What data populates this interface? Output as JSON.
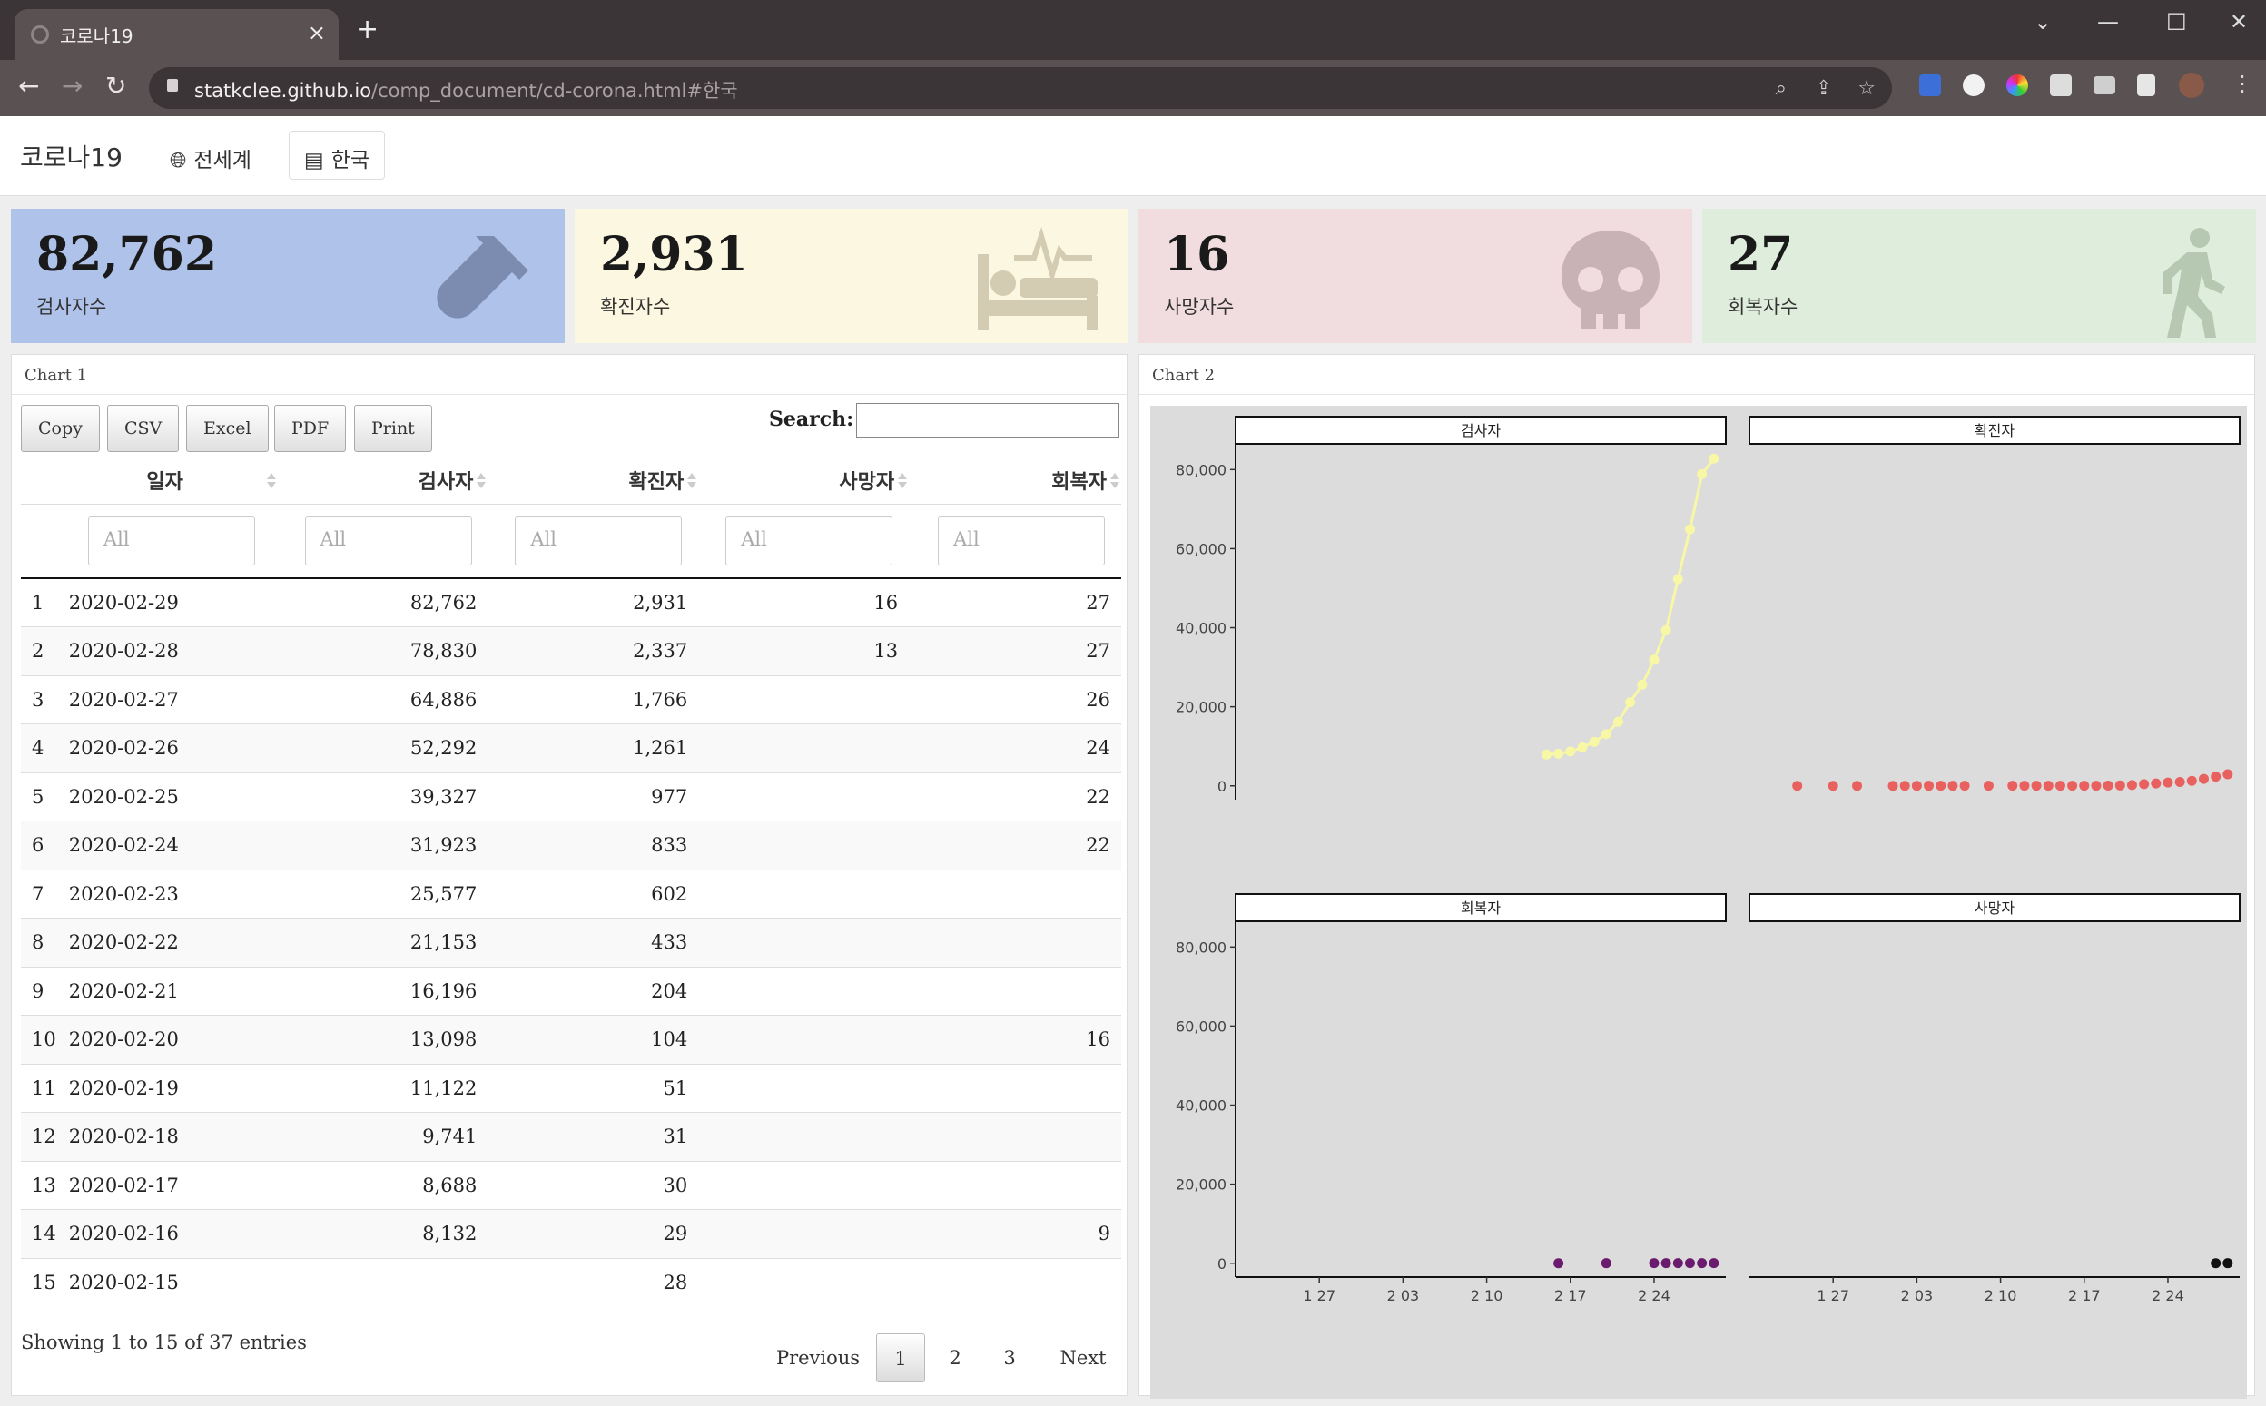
{
  "browser": {
    "tab_title": "코로나19",
    "tab_close": "×",
    "new_tab": "+",
    "url_domain": "statkclee.github.io",
    "url_path": "/comp_document/cd-corona.html#한국",
    "back": "←",
    "forward": "→",
    "reload": "↻"
  },
  "navbar": {
    "brand": "코로나19",
    "links": [
      {
        "label": "전세계",
        "icon": "globe-icon"
      },
      {
        "label": "한국",
        "icon": "map-icon",
        "active": true
      }
    ]
  },
  "value_boxes": [
    {
      "value": "82,762",
      "caption": "검사자수",
      "color": "#afc2ea",
      "icon": "vial-icon"
    },
    {
      "value": "2,931",
      "caption": "확진자수",
      "color": "#fcf7e0",
      "icon": "procedures-icon"
    },
    {
      "value": "16",
      "caption": "사망자수",
      "color": "#f1dce0",
      "icon": "skull-icon"
    },
    {
      "value": "27",
      "caption": "회복자수",
      "color": "#dfeddc",
      "icon": "walking-icon"
    }
  ],
  "chart1": {
    "title": "Chart 1",
    "buttons": [
      "Copy",
      "CSV",
      "Excel",
      "PDF",
      "Print"
    ],
    "search_label": "Search:",
    "columns": [
      "",
      "일자",
      "검사자",
      "확진자",
      "사망자",
      "회복자"
    ],
    "filter_placeholder": "All",
    "rows": [
      [
        "1",
        "2020-02-29",
        "82,762",
        "2,931",
        "16",
        "27"
      ],
      [
        "2",
        "2020-02-28",
        "78,830",
        "2,337",
        "13",
        "27"
      ],
      [
        "3",
        "2020-02-27",
        "64,886",
        "1,766",
        "",
        "26"
      ],
      [
        "4",
        "2020-02-26",
        "52,292",
        "1,261",
        "",
        "24"
      ],
      [
        "5",
        "2020-02-25",
        "39,327",
        "977",
        "",
        "22"
      ],
      [
        "6",
        "2020-02-24",
        "31,923",
        "833",
        "",
        "22"
      ],
      [
        "7",
        "2020-02-23",
        "25,577",
        "602",
        "",
        ""
      ],
      [
        "8",
        "2020-02-22",
        "21,153",
        "433",
        "",
        ""
      ],
      [
        "9",
        "2020-02-21",
        "16,196",
        "204",
        "",
        ""
      ],
      [
        "10",
        "2020-02-20",
        "13,098",
        "104",
        "",
        "16"
      ],
      [
        "11",
        "2020-02-19",
        "11,122",
        "51",
        "",
        ""
      ],
      [
        "12",
        "2020-02-18",
        "9,741",
        "31",
        "",
        ""
      ],
      [
        "13",
        "2020-02-17",
        "8,688",
        "30",
        "",
        ""
      ],
      [
        "14",
        "2020-02-16",
        "8,132",
        "29",
        "",
        "9"
      ],
      [
        "15",
        "2020-02-15",
        "",
        "28",
        "",
        ""
      ]
    ],
    "info": "Showing 1 to 15 of 37 entries",
    "pagination": {
      "previous": "Previous",
      "pages": [
        "1",
        "2",
        "3"
      ],
      "current": "1",
      "next": "Next"
    }
  },
  "chart2": {
    "title": "Chart 2"
  },
  "chart_data": {
    "type": "scatter",
    "facets": [
      {
        "title": "검사자",
        "color": "#f8f7a6",
        "x": [
          "2020-02-15",
          "2020-02-16",
          "2020-02-17",
          "2020-02-18",
          "2020-02-19",
          "2020-02-20",
          "2020-02-21",
          "2020-02-22",
          "2020-02-23",
          "2020-02-24",
          "2020-02-25",
          "2020-02-26",
          "2020-02-27",
          "2020-02-28",
          "2020-02-29"
        ],
        "y": [
          7919,
          8132,
          8688,
          9741,
          11122,
          13098,
          16196,
          21153,
          25577,
          31923,
          39327,
          52292,
          64886,
          78830,
          82762
        ],
        "line": true
      },
      {
        "title": "확진자",
        "color": "#e8615f",
        "x": [
          "2020-01-24",
          "2020-01-27",
          "2020-01-29",
          "2020-02-01",
          "2020-02-02",
          "2020-02-03",
          "2020-02-04",
          "2020-02-05",
          "2020-02-06",
          "2020-02-07",
          "2020-02-09",
          "2020-02-11",
          "2020-02-12",
          "2020-02-13",
          "2020-02-14",
          "2020-02-15",
          "2020-02-16",
          "2020-02-17",
          "2020-02-18",
          "2020-02-19",
          "2020-02-20",
          "2020-02-21",
          "2020-02-22",
          "2020-02-23",
          "2020-02-24",
          "2020-02-25",
          "2020-02-26",
          "2020-02-27",
          "2020-02-28",
          "2020-02-29"
        ],
        "y": [
          2,
          4,
          4,
          12,
          15,
          15,
          16,
          19,
          23,
          24,
          25,
          28,
          28,
          28,
          28,
          28,
          29,
          30,
          31,
          51,
          104,
          204,
          433,
          602,
          833,
          977,
          1261,
          1766,
          2337,
          2931
        ],
        "line": false
      },
      {
        "title": "회복자",
        "color": "#6a1b6e",
        "x": [
          "2020-02-16",
          "2020-02-20",
          "2020-02-24",
          "2020-02-25",
          "2020-02-26",
          "2020-02-27",
          "2020-02-28",
          "2020-02-29"
        ],
        "y": [
          9,
          16,
          22,
          22,
          24,
          26,
          27,
          27
        ],
        "line": false
      },
      {
        "title": "사망자",
        "color": "#111111",
        "x": [
          "2020-02-28",
          "2020-02-29"
        ],
        "y": [
          13,
          16
        ],
        "line": false
      }
    ],
    "x_ticks": [
      "1 27",
      "2 03",
      "2 10",
      "2 17",
      "2 24"
    ],
    "x_tick_dates": [
      "2020-01-27",
      "2020-02-03",
      "2020-02-10",
      "2020-02-17",
      "2020-02-24"
    ],
    "x_range": [
      "2020-01-20",
      "2020-03-01"
    ],
    "y_ticks": [
      "0",
      "20,000",
      "40,000",
      "60,000",
      "80,000"
    ],
    "y_tick_values": [
      0,
      20000,
      40000,
      60000,
      80000
    ],
    "ylim": [
      -3500,
      86500
    ],
    "background": "#dcdcdc",
    "grid": false
  }
}
